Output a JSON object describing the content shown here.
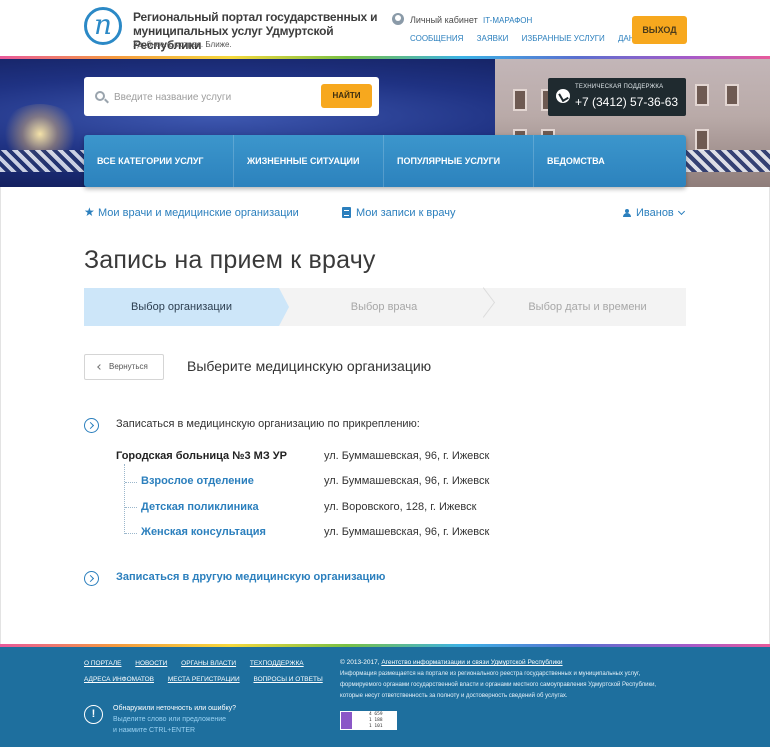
{
  "header": {
    "title": "Региональный портал государственных и муниципальных услуг Удмуртской Республики",
    "slogan": "Удобнее. Быстрее. Ближе.",
    "personal_cabinet": "Личный кабинет",
    "it_marathon": "IT-МАРАФОН",
    "nav": [
      "СООБЩЕНИЯ",
      "ЗАЯВКИ",
      "ИЗБРАННЫЕ УСЛУГИ",
      "ДАННЫЕ"
    ],
    "exit_label": "ВЫХОД"
  },
  "search": {
    "placeholder": "Введите название услуги",
    "button": "НАЙТИ"
  },
  "support": {
    "label": "ТЕХНИЧЕСКАЯ ПОДДЕРЖКА",
    "phone": "+7 (3412) 57-36-63"
  },
  "main_nav": [
    "ВСЕ КАТЕГОРИИ УСЛУГ",
    "ЖИЗНЕННЫЕ СИТУАЦИИ",
    "ПОПУЛЯРНЫЕ УСЛУГИ",
    "ВЕДОМСТВА"
  ],
  "sub_nav": {
    "doctors": "Мои врачи и медицинские организации",
    "appointments": "Мои записи к врачу",
    "user": "Иванов"
  },
  "page_title": "Запись на прием к врачу",
  "steps": [
    "Выбор организации",
    "Выбор врача",
    "Выбор даты и времени"
  ],
  "back_label": "Вернуться",
  "section_title": "Выберите медицинскую организацию",
  "attach_text": "Записаться в медицинскую организацию по прикреплению:",
  "main_org": {
    "name": "Городская больница №3 МЗ УР",
    "address": "ул. Буммашевская, 96, г. Ижевск"
  },
  "departments": [
    {
      "name": "Взрослое отделение",
      "address": "ул. Буммашевская, 96, г. Ижевск"
    },
    {
      "name": "Детская поликлиника",
      "address": "ул. Воровского, 128, г. Ижевск"
    },
    {
      "name": "Женская консультация",
      "address": "ул. Буммашевская, 96, г. Ижевск"
    }
  ],
  "other_org": "Записаться в другую медицинскую организацию",
  "footer": {
    "links_row1": [
      "О ПОРТАЛЕ",
      "НОВОСТИ",
      "ОРГАНЫ ВЛАСТИ",
      "ТЕХПОДДЕРЖКА"
    ],
    "links_row2": [
      "АДРЕСА ИНФОМАТОВ",
      "МЕСТА РЕГИСТРАЦИИ",
      "ВОПРОСЫ И ОТВЕТЫ"
    ],
    "error_title": "Обнаружили неточность или ошибку?",
    "error_hint_1": "Выделите слово или предложение",
    "error_hint_2": "и нажмите CTRL+ENTER",
    "copyright": "© 2013-2017,",
    "agency": "Агентство информатизации и связи Удмуртской Республики",
    "info_1": "Информация размещается на портале из регионального реестра государственных и муниципальных услуг,",
    "info_2": "формируемого органами государственной власти и органами местного самоуправления Удмуртской Республики,",
    "info_3": "которые несут ответственность за полноту и достоверность сведений об услугах.",
    "counter": [
      "4 659",
      "1 188",
      "1 101"
    ]
  }
}
